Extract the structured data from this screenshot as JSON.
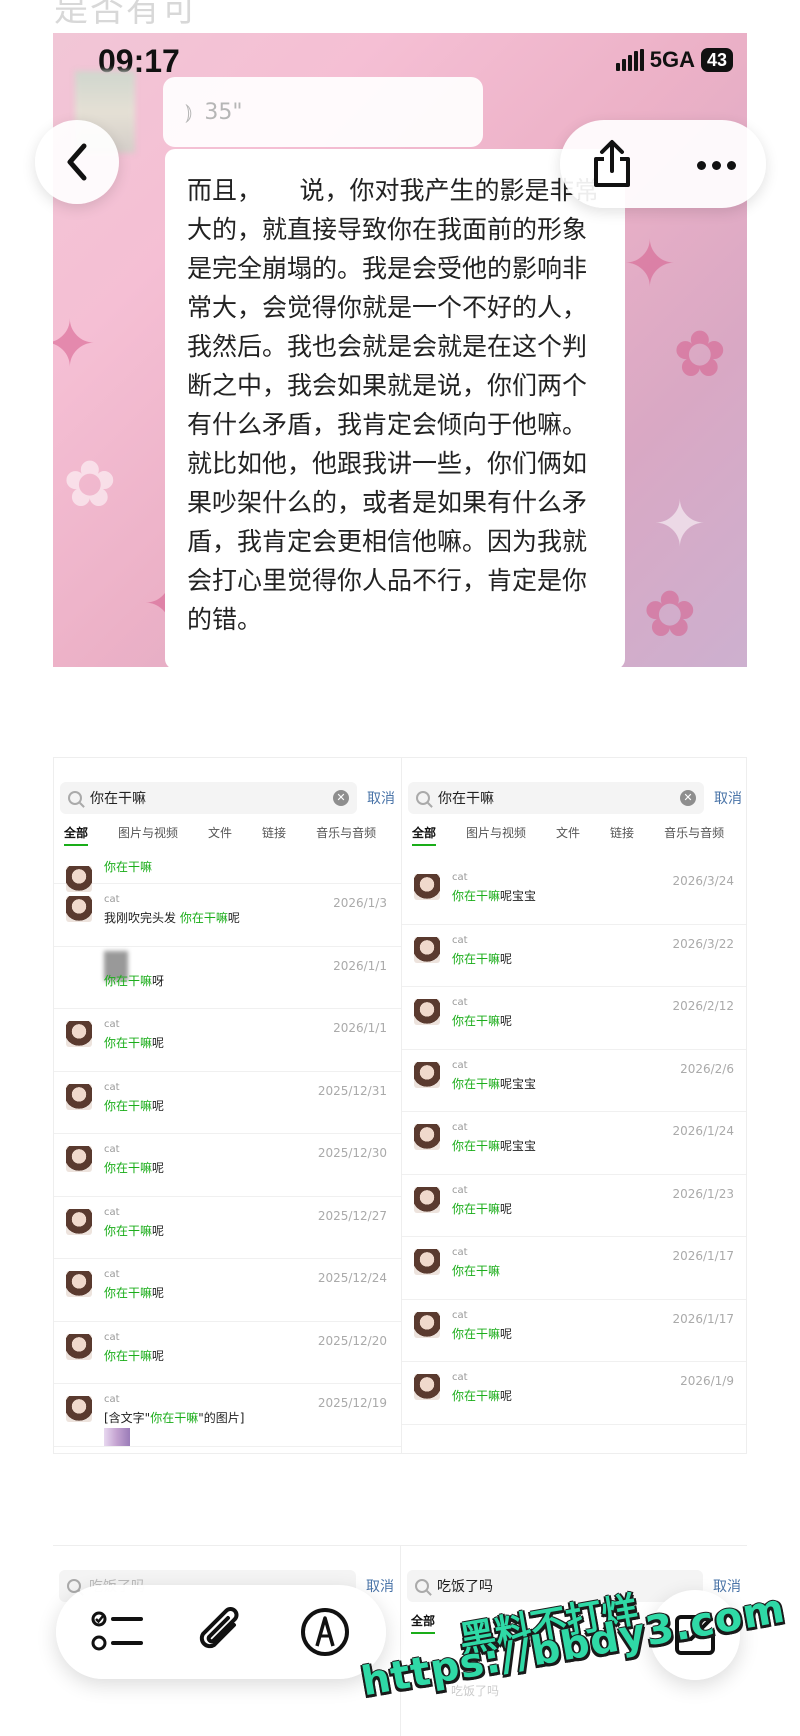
{
  "top_title": "是否有可",
  "chat": {
    "time": "09:17",
    "network": "5GA",
    "battery": "43",
    "voice_duration": "35\"",
    "message": "而且，　　说，你对我产生的影是非常大的，就直接导致你在我面前的形象是完全崩塌的。我是会受他的影响非常大，会觉得你就是一个不好的人，我然后。我也会就是会就是在这个判断之中，我会如果就是说，你们两个有什么矛盾，我肯定会倾向于他嘛。就比如他，他跟我讲一些，你们俩如果吵架什么的，或者是如果有什么矛盾，我肯定会更相信他嘛。因为我就会打心里觉得你人品不行，肯定是你的错。",
    "icons": {
      "back": "chevron-left-icon",
      "share": "share-icon",
      "more": "more-dots-icon"
    }
  },
  "search_left": {
    "query": "你在干嘛",
    "cancel": "取消",
    "tabs": [
      "全部",
      "图片与视频",
      "文件",
      "链接",
      "音乐与音频"
    ],
    "rows": [
      {
        "name": "",
        "pre": "",
        "hl": "你在干嘛",
        "post": "",
        "date": ""
      },
      {
        "name": "cat",
        "pre": "我刚吹完头发 ",
        "hl": "你在干嘛",
        "post": "呢",
        "date": "2026/1/3"
      },
      {
        "name": "",
        "pre": "",
        "hl": "你在干嘛",
        "post": "呀",
        "date": "2026/1/1"
      },
      {
        "name": "cat",
        "pre": "",
        "hl": "你在干嘛",
        "post": "呢",
        "date": "2026/1/1"
      },
      {
        "name": "cat",
        "pre": "",
        "hl": "你在干嘛",
        "post": "呢",
        "date": "2025/12/31"
      },
      {
        "name": "cat",
        "pre": "",
        "hl": "你在干嘛",
        "post": "呢",
        "date": "2025/12/30"
      },
      {
        "name": "cat",
        "pre": "",
        "hl": "你在干嘛",
        "post": "呢",
        "date": "2025/12/27"
      },
      {
        "name": "cat",
        "pre": "",
        "hl": "你在干嘛",
        "post": "呢",
        "date": "2025/12/24"
      },
      {
        "name": "cat",
        "pre": "",
        "hl": "你在干嘛",
        "post": "呢",
        "date": "2025/12/20"
      },
      {
        "name": "cat",
        "pre": "[含文字\"",
        "hl": "你在干嘛",
        "post": "\"的图片]",
        "date": "2025/12/19"
      }
    ]
  },
  "search_right": {
    "query": "你在干嘛",
    "cancel": "取消",
    "tabs": [
      "全部",
      "图片与视频",
      "文件",
      "链接",
      "音乐与音频"
    ],
    "rows": [
      {
        "name": "cat",
        "pre": "",
        "hl": "你在干嘛",
        "post": "呢宝宝",
        "date": "2026/3/24"
      },
      {
        "name": "cat",
        "pre": "",
        "hl": "你在干嘛",
        "post": "呢",
        "date": "2026/3/22"
      },
      {
        "name": "cat",
        "pre": "",
        "hl": "你在干嘛",
        "post": "呢",
        "date": "2026/2/12"
      },
      {
        "name": "cat",
        "pre": "",
        "hl": "你在干嘛",
        "post": "呢宝宝",
        "date": "2026/2/6"
      },
      {
        "name": "cat",
        "pre": "",
        "hl": "你在干嘛",
        "post": "呢宝宝",
        "date": "2026/1/24"
      },
      {
        "name": "cat",
        "pre": "",
        "hl": "你在干嘛",
        "post": "呢",
        "date": "2026/1/23"
      },
      {
        "name": "cat",
        "pre": "",
        "hl": "你在干嘛",
        "post": "",
        "date": "2026/1/17"
      },
      {
        "name": "cat",
        "pre": "",
        "hl": "你在干嘛",
        "post": "呢",
        "date": "2026/1/17"
      },
      {
        "name": "cat",
        "pre": "",
        "hl": "你在干嘛",
        "post": "呢",
        "date": "2026/1/9"
      }
    ]
  },
  "bottom": {
    "left_query": "吃饭了吗",
    "right_query": "吃饭了吗",
    "cancel": "取消",
    "tab_all": "全部",
    "result_hint": "吃饭了吗"
  },
  "toolbar": {
    "icons": [
      "checklist-icon",
      "paperclip-icon",
      "markup-pen-icon",
      "compose-icon"
    ]
  },
  "watermark": {
    "line1": "黑料不打烊",
    "line2": "https://bbdy3.com"
  }
}
